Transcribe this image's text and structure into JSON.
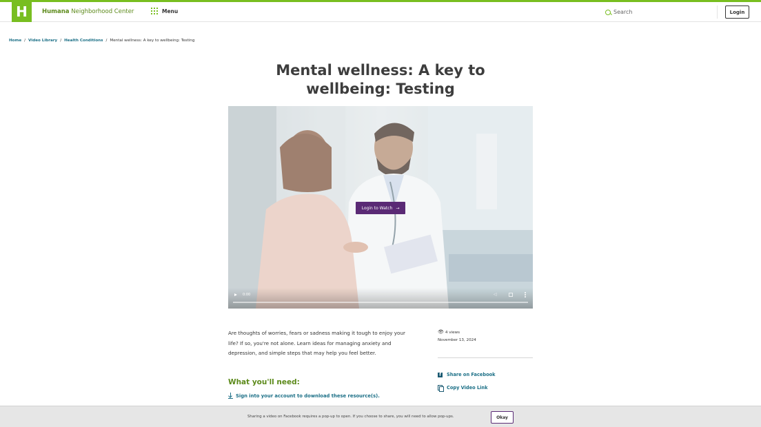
{
  "header": {
    "logo_letter": "H",
    "brand_bold": "Humana",
    "brand_rest": " Neighborhood Center",
    "menu_label": "Menu",
    "search_placeholder": "Search",
    "login_label": "Login"
  },
  "breadcrumb": [
    {
      "label": "Home"
    },
    {
      "label": "Video Library"
    },
    {
      "label": "Health Conditions"
    },
    {
      "label": "Mental wellness: A key to wellbeing: Testing"
    }
  ],
  "breadcrumb_separator": "/",
  "page": {
    "title": "Mental wellness: A key to wellbeing: Testing"
  },
  "video": {
    "watch_label": "Login to Watch",
    "watch_arrow": "→",
    "time": "0:00",
    "progress_fraction": 0
  },
  "description": "Are thoughts of worries, fears or sadness making it tough to enjoy your life? If so, you're not alone. Learn ideas for managing anxiety and depression, and simple steps that may help you feel better.",
  "meta": {
    "views": "4 views",
    "date": "November 13, 2024"
  },
  "share": {
    "facebook": "Share on Facebook",
    "copy_link": "Copy Video Link"
  },
  "need": {
    "title": "What you'll need:",
    "link": "Sign into your account to download these resource(s)."
  },
  "cookie": {
    "text": "Sharing a video on Facebook requires a pop-up to open. If you choose to share, you will need to allow pop-ups.",
    "button": "Okay"
  },
  "colors": {
    "brand_green": "#78be20",
    "link_teal": "#1b6f86",
    "purple": "#5a2a75"
  }
}
